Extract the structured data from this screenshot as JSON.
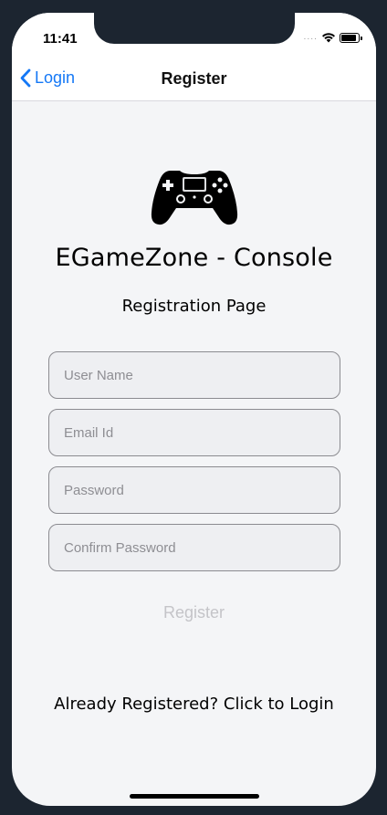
{
  "status_bar": {
    "time": "11:41",
    "signal_dots": "....",
    "icons": [
      "wifi-icon",
      "battery-icon"
    ]
  },
  "nav": {
    "back_label": "Login",
    "title": "Register"
  },
  "app": {
    "title": "EGameZone - Console",
    "subtitle": "Registration Page",
    "logo_icon": "gamepad-icon"
  },
  "form": {
    "username": {
      "value": "",
      "placeholder": "User Name"
    },
    "email": {
      "value": "",
      "placeholder": "Email Id"
    },
    "password": {
      "value": "",
      "placeholder": "Password"
    },
    "confirm_password": {
      "value": "",
      "placeholder": "Confirm Password"
    },
    "register_label": "Register"
  },
  "footer": {
    "login_link": "Already Registered? Click to Login"
  },
  "colors": {
    "accent": "#1478f6",
    "disabled_text": "#c4c4c8",
    "screen_bg": "#f4f5f7"
  }
}
